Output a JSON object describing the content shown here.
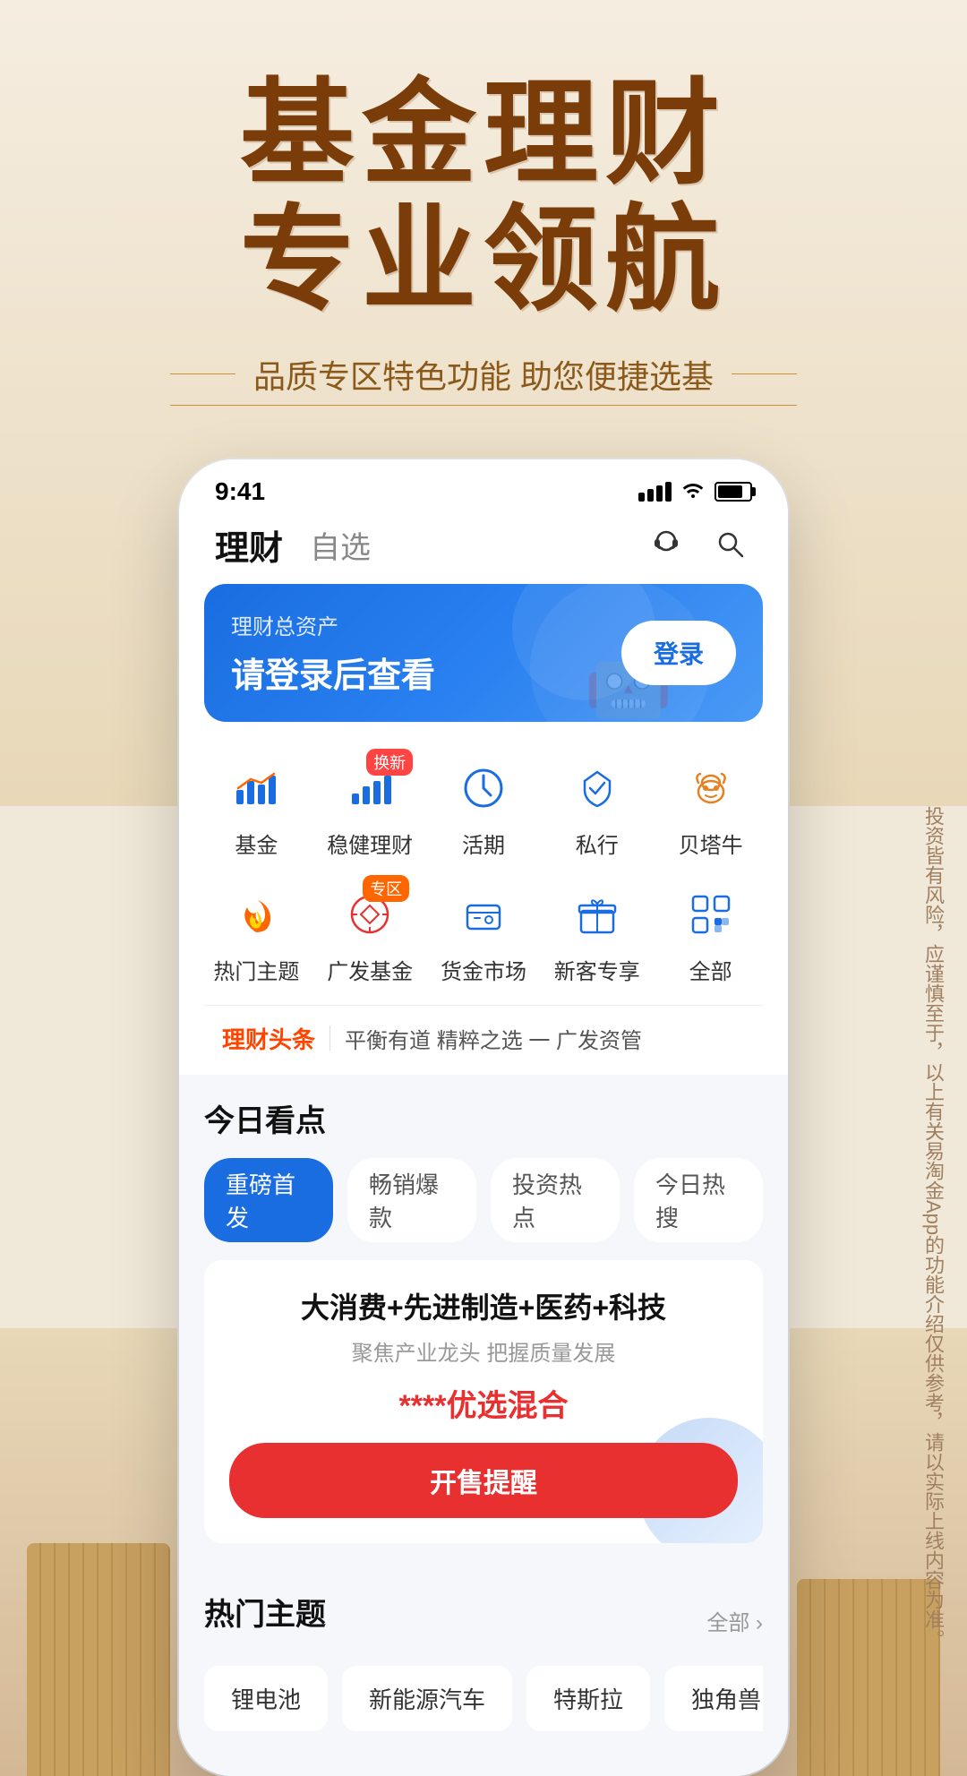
{
  "hero": {
    "title_line1": "基金理财",
    "title_line2": "专业领航",
    "subtitle": "品质专区特色功能 助您便捷选基"
  },
  "phone": {
    "status": {
      "time": "9:41"
    },
    "nav": {
      "tab_active": "理财",
      "tab_inactive": "自选"
    },
    "banner": {
      "label": "理财总资产",
      "main_text": "请登录后查看",
      "login_btn": "登录"
    },
    "icon_grid": {
      "row1": [
        {
          "label": "基金",
          "badge": "",
          "icon": "chart"
        },
        {
          "label": "稳健理财",
          "badge": "换新",
          "icon": "bar"
        },
        {
          "label": "活期",
          "badge": "",
          "icon": "clock"
        },
        {
          "label": "私行",
          "badge": "",
          "icon": "crown"
        },
        {
          "label": "贝塔牛",
          "badge": "",
          "icon": "bull"
        }
      ],
      "row2": [
        {
          "label": "热门主题",
          "badge": "",
          "icon": "fire"
        },
        {
          "label": "广发基金",
          "badge": "专区",
          "icon": "compass"
        },
        {
          "label": "货金市场",
          "badge": "",
          "icon": "wallet"
        },
        {
          "label": "新客专享",
          "badge": "",
          "icon": "gift"
        },
        {
          "label": "全部",
          "badge": "",
          "icon": "grid"
        }
      ]
    },
    "news": {
      "brand": "理财头条",
      "divider": "|",
      "text": "平衡有道 精粹之选 一 广发资管"
    },
    "today": {
      "section_title": "今日看点",
      "filters": [
        "重磅首发",
        "畅销爆款",
        "投资热点",
        "今日热搜"
      ]
    },
    "fund_card": {
      "title": "大消费+先进制造+医药+科技",
      "subtitle": "聚焦产业龙头 把握质量发展",
      "name": "****优选混合",
      "remind_btn": "开售提醒"
    },
    "hot_themes": {
      "section_title": "热门主题",
      "more_label": "全部 ›",
      "tags": [
        "锂电池",
        "新能源汽车",
        "特斯拉",
        "独角兽"
      ]
    }
  },
  "side_text": "投资皆有风险，应谨慎至于，以上有关易淘金App的功能介绍仅供参考，请以实际上线内容为准。",
  "colors": {
    "brand_blue": "#1a6de0",
    "brand_red": "#e83030",
    "hero_brown": "#7a3d0a",
    "bg_cream": "#f0e8d8"
  }
}
